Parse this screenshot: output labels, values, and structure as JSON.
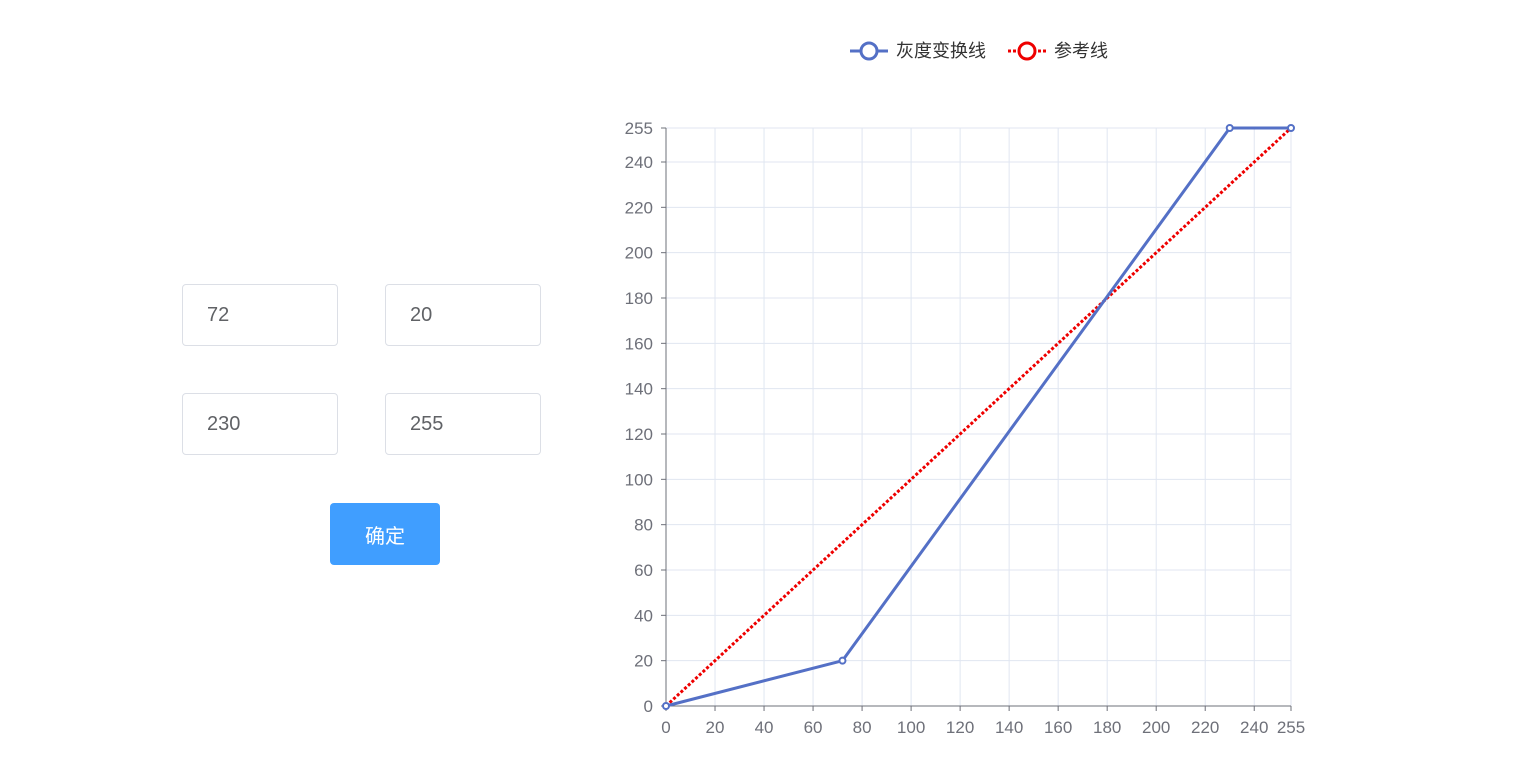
{
  "inputs": {
    "r1": "72",
    "s1": "20",
    "r2": "230",
    "s2": "255"
  },
  "confirm_label": "确定",
  "colors": {
    "series_main": "#5470c6",
    "series_ref": "#ee0000",
    "button": "#409eff",
    "grid": "#e0e6f1",
    "axis": "#6e7079"
  },
  "chart_data": {
    "type": "line",
    "legend": {
      "placement": "top-center"
    },
    "grid": true,
    "x_ticks": [
      0,
      20,
      40,
      60,
      80,
      100,
      120,
      140,
      160,
      180,
      200,
      220,
      240,
      255
    ],
    "y_ticks": [
      0,
      20,
      40,
      60,
      80,
      100,
      120,
      140,
      160,
      180,
      200,
      220,
      240,
      255
    ],
    "xlim": [
      0,
      255
    ],
    "ylim": [
      0,
      255
    ],
    "series": [
      {
        "name": "灰度变换线",
        "color": "#5470c6",
        "style": "solid",
        "points": [
          [
            0,
            0
          ],
          [
            72,
            20
          ],
          [
            230,
            255
          ],
          [
            255,
            255
          ]
        ]
      },
      {
        "name": "参考线",
        "color": "#ee0000",
        "style": "dotted",
        "points": [
          [
            0,
            0
          ],
          [
            255,
            255
          ]
        ]
      }
    ]
  }
}
